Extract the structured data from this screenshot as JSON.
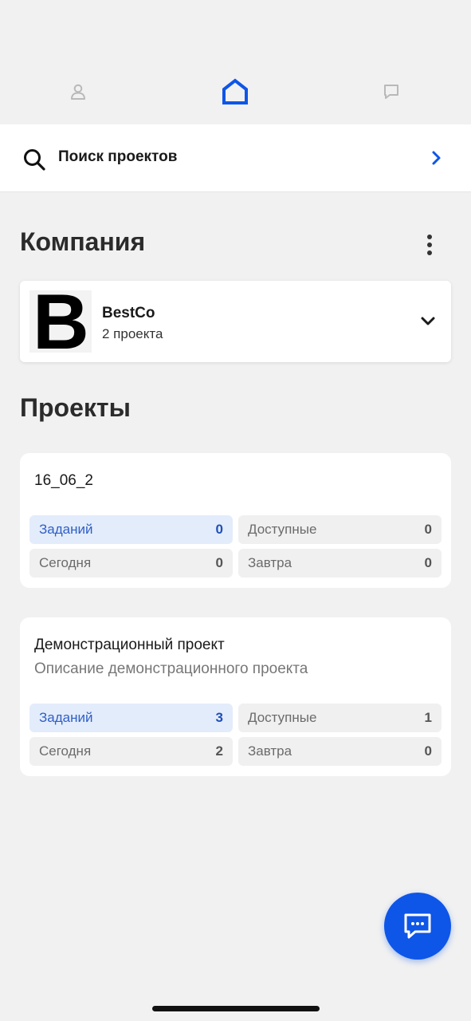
{
  "nav": {
    "items": [
      {
        "icon": "profile-icon",
        "active": false
      },
      {
        "icon": "home-icon",
        "active": true
      },
      {
        "icon": "chat-icon",
        "active": false
      }
    ],
    "active_color": "#0e56e8",
    "inactive_color": "#b9b9b9"
  },
  "search": {
    "label": "Поиск проектов",
    "icon": "search-icon",
    "chevron_color": "#0e56e8"
  },
  "company_section": {
    "title": "Компания",
    "company": {
      "logo_letter": "B",
      "name": "BestCo",
      "projects_count": "2 проекта"
    }
  },
  "projects_section": {
    "title": "Проекты",
    "projects": [
      {
        "name": "16_06_2",
        "description": "",
        "stats": [
          {
            "label": "Заданий",
            "value": "0"
          },
          {
            "label": "Доступные",
            "value": "0"
          },
          {
            "label": "Сегодня",
            "value": "0"
          },
          {
            "label": "Завтра",
            "value": "0"
          }
        ]
      },
      {
        "name": "Демонстрационный проект",
        "description": "Описание демонстрационного проекта",
        "stats": [
          {
            "label": "Заданий",
            "value": "3"
          },
          {
            "label": "Доступные",
            "value": "1"
          },
          {
            "label": "Сегодня",
            "value": "2"
          },
          {
            "label": "Завтра",
            "value": "0"
          }
        ]
      }
    ]
  },
  "fab": {
    "icon": "message-icon",
    "color": "#0e56e8"
  }
}
